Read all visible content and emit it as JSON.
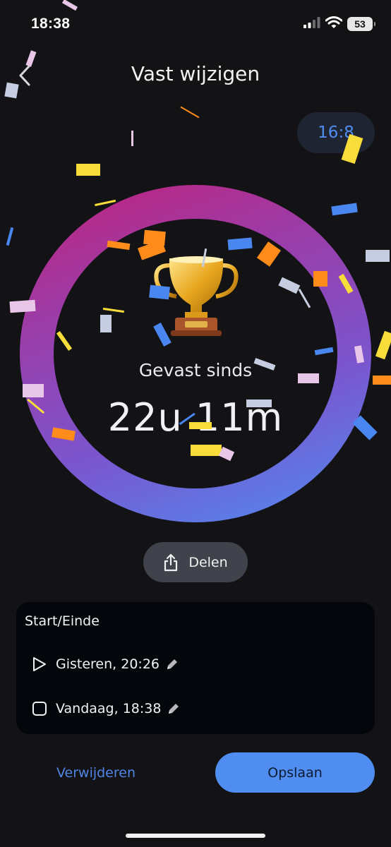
{
  "status_bar": {
    "time": "18:38",
    "battery_level": "53",
    "icons": [
      "cellular-signal-icon",
      "wifi-icon",
      "battery-icon"
    ]
  },
  "header": {
    "title": "Vast wijzigen",
    "back_icon": "chevron-left-icon"
  },
  "plan_badge": {
    "label": "16:8"
  },
  "progress_ring": {
    "achievement_icon": "trophy-icon",
    "label": "Gevast sinds",
    "value": "22u 11m",
    "gradient_colors": [
      "#c2227a",
      "#9d3ba6",
      "#7a56cf",
      "#4e8df0"
    ]
  },
  "share": {
    "label": "Delen",
    "icon": "share-icon"
  },
  "start_end": {
    "title": "Start/Einde",
    "start": {
      "icon": "play-icon",
      "value": "Gisteren, 20:26",
      "edit_icon": "pencil-icon"
    },
    "end": {
      "icon": "stop-icon",
      "value": "Vandaag, 18:38",
      "edit_icon": "pencil-icon"
    }
  },
  "actions": {
    "delete_label": "Verwijderen",
    "save_label": "Opslaan"
  },
  "colors": {
    "background": "#131316",
    "accent": "#4f8df0",
    "card": "#03060b",
    "share_button": "#40434b",
    "plan_badge_bg": "#1e2432"
  }
}
